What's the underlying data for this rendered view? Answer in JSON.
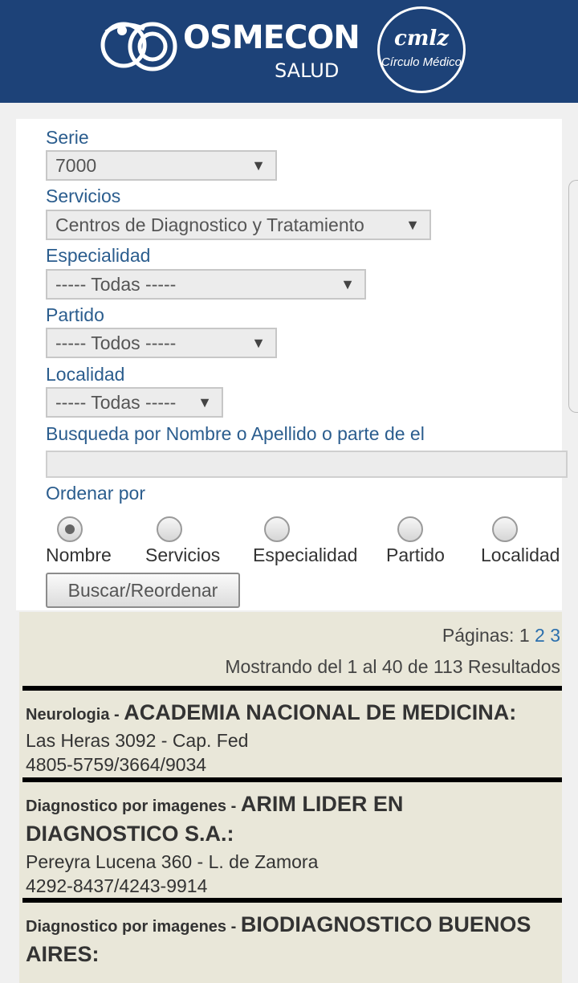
{
  "header": {
    "brand_name": "OSMECON",
    "brand_sub": "SALUD",
    "partner_logo": "cmlz",
    "partner_sub": "Círculo Médico"
  },
  "form": {
    "serie": {
      "label": "Serie",
      "value": "7000"
    },
    "servicios": {
      "label": "Servicios",
      "value": "Centros de Diagnostico y Tratamiento"
    },
    "especialidad": {
      "label": "Especialidad",
      "value": "----- Todas -----"
    },
    "partido": {
      "label": "Partido",
      "value": "----- Todos -----"
    },
    "localidad": {
      "label": "Localidad",
      "value": "----- Todas -----"
    },
    "busqueda": {
      "label": "Busqueda por Nombre o Apellido o parte de el",
      "value": ""
    },
    "ordenar": {
      "label": "Ordenar por",
      "options": [
        "Nombre",
        "Servicios",
        "Especialidad",
        "Partido",
        "Localidad"
      ],
      "selected": "Nombre"
    },
    "submit_label": "Buscar/Reordenar"
  },
  "results": {
    "pages_label": "Páginas:",
    "pages": [
      "1",
      "2",
      "3"
    ],
    "current_page": "1",
    "showing": "Mostrando del 1 al 40 de 113 Resultados",
    "items": [
      {
        "category": "Neurologia",
        "separator": " - ",
        "name": "ACADEMIA NACIONAL DE MEDICINA:",
        "address": "Las Heras 3092 - Cap. Fed",
        "phone": "4805-5759/3664/9034"
      },
      {
        "category": "Diagnostico por imagenes",
        "separator": " - ",
        "name": "ARIM LIDER EN DIAGNOSTICO S.A.:",
        "address": "Pereyra Lucena 360 - L. de Zamora",
        "phone": "4292-8437/4243-9914"
      },
      {
        "category": "Diagnostico por imagenes",
        "separator": " - ",
        "name": "BIODIAGNOSTICO BUENOS AIRES:",
        "address": "",
        "phone": ""
      }
    ]
  },
  "icons": {
    "dropdown": "chevron-down-icon",
    "brand": "osmecon-logo-icon"
  },
  "colors": {
    "header_bg": "#1d4278",
    "label_text": "#2b5d8e",
    "results_bg": "#e9e7d9",
    "page_link": "#2b6fad"
  }
}
